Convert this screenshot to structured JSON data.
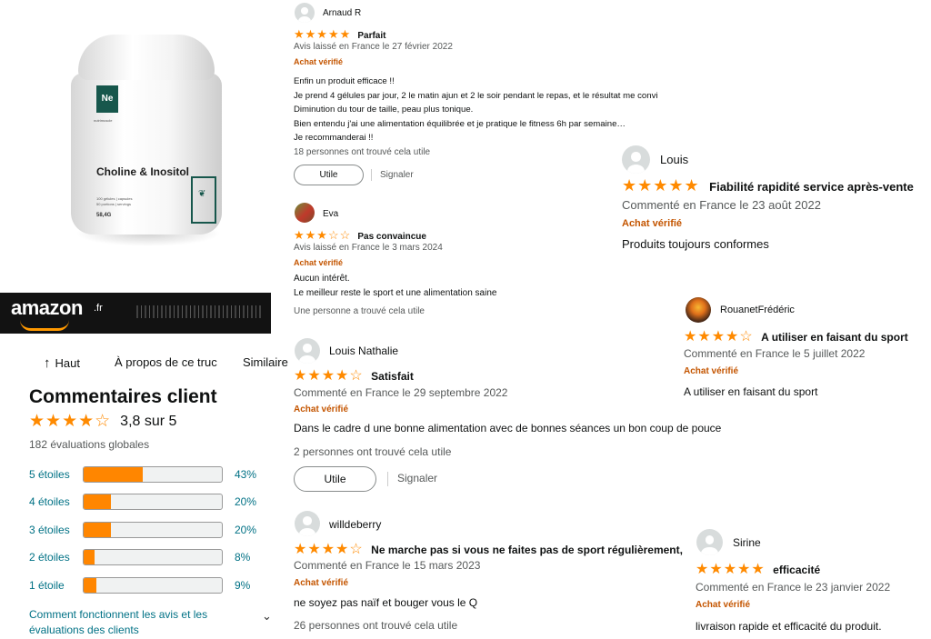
{
  "product": {
    "logo_text": "Ne",
    "brand_text": "nutrimuscle",
    "name": "Choline & Inositol",
    "small_lines": [
      "100 gélules | capsules",
      "50 portions | servings"
    ],
    "weight": "58,4G"
  },
  "amazon": {
    "logo": "amazon",
    "tld": ".fr"
  },
  "nav": {
    "back": "Haut",
    "about": "À propos de ce truc",
    "similar": "Similaire"
  },
  "ratings": {
    "heading": "Commentaires client",
    "average_stars": "★★★★☆",
    "average_value": 3.8,
    "average_text": "3,8 sur 5",
    "global": "182 évaluations globales",
    "histogram": [
      {
        "label": "5 étoiles",
        "percent": 43,
        "pct_text": "43%"
      },
      {
        "label": "4 étoiles",
        "percent": 20,
        "pct_text": "20%"
      },
      {
        "label": "3 étoiles",
        "percent": 20,
        "pct_text": "20%"
      },
      {
        "label": "2 étoiles",
        "percent": 8,
        "pct_text": "8%"
      },
      {
        "label": "1 étoile",
        "percent": 9,
        "pct_text": "9%"
      }
    ],
    "how_link": "Comment fonctionnent les avis et les évaluations des clients"
  },
  "reviews": {
    "arnaud": {
      "name": "Arnaud R",
      "stars": "★★★★★",
      "rating": 5,
      "title": "Parfait",
      "meta": "Avis laissé en France le 27 février 2022",
      "verified": "Achat vérifié",
      "lines": [
        "Enfin un produit efficace !!",
        "Je prend 4 gélules par jour, 2 le matin ajun et 2 le soir pendant le repas, et le résultat me convi",
        "Diminution du tour de taille, peau plus tonique.",
        "Bien entendu j'ai une alimentation équilibrée et je pratique le fitness 6h par semaine…",
        "Je recommanderai !!"
      ],
      "helpful": "18 personnes ont trouvé cela utile",
      "button": "Utile",
      "report": "Signaler"
    },
    "eva": {
      "name": "Eva",
      "stars": "★★★☆☆",
      "rating": 3,
      "title": "Pas convaincue",
      "meta": "Avis laissé en France le 3 mars 2024",
      "verified": "Achat vérifié",
      "lines": [
        "Aucun intérêt.",
        "Le meilleur reste le sport et une alimentation saine"
      ],
      "helpful": "Une personne a trouvé cela utile"
    },
    "louis_nathalie": {
      "name": "Louis Nathalie",
      "stars": "★★★★☆",
      "rating": 4,
      "title": "Satisfait",
      "meta": "Commenté en France le 29 septembre 2022",
      "verified": "Achat vérifié",
      "body": "Dans le cadre d une bonne alimentation avec de bonnes séances un bon coup de pouce",
      "helpful": "2 personnes ont trouvé cela utile",
      "button": "Utile",
      "report": "Signaler"
    },
    "willdeberry": {
      "name": "willdeberry",
      "stars": "★★★★☆",
      "rating": 4,
      "title": "Ne marche pas si vous ne faites pas de sport régulièrement,",
      "meta": "Commenté en France le 15 mars 2023",
      "verified": "Achat vérifié",
      "body": "ne soyez pas naïf et bouger vous le Q",
      "helpful": "26 personnes ont trouvé cela utile"
    },
    "louis": {
      "name": "Louis",
      "stars": "★★★★★",
      "rating": 5,
      "title": "Fiabilité rapidité service après-vente",
      "meta": "Commenté en France le 23 août 2022",
      "verified": "Achat vérifié",
      "body": "Produits toujours conformes"
    },
    "rouanet": {
      "name": "RouanetFrédéric",
      "stars": "★★★★☆",
      "rating": 4,
      "title": "A utiliser en faisant du sport",
      "meta": "Commenté en France le 5 juillet 2022",
      "verified": "Achat vérifié",
      "body": "A utiliser en faisant du sport"
    },
    "sirine": {
      "name": "Sirine",
      "stars": "★★★★★",
      "rating": 5,
      "title": "efficacité",
      "meta": "Commenté en France le 23 janvier 2022",
      "verified": "Achat vérifié",
      "body": "livraison rapide et efficacité du produit."
    }
  },
  "colors": {
    "star": "#ff8a00",
    "bar_fill": "#ff8600",
    "link": "#007185",
    "verified": "#c45500",
    "brand_green": "#17574c"
  }
}
